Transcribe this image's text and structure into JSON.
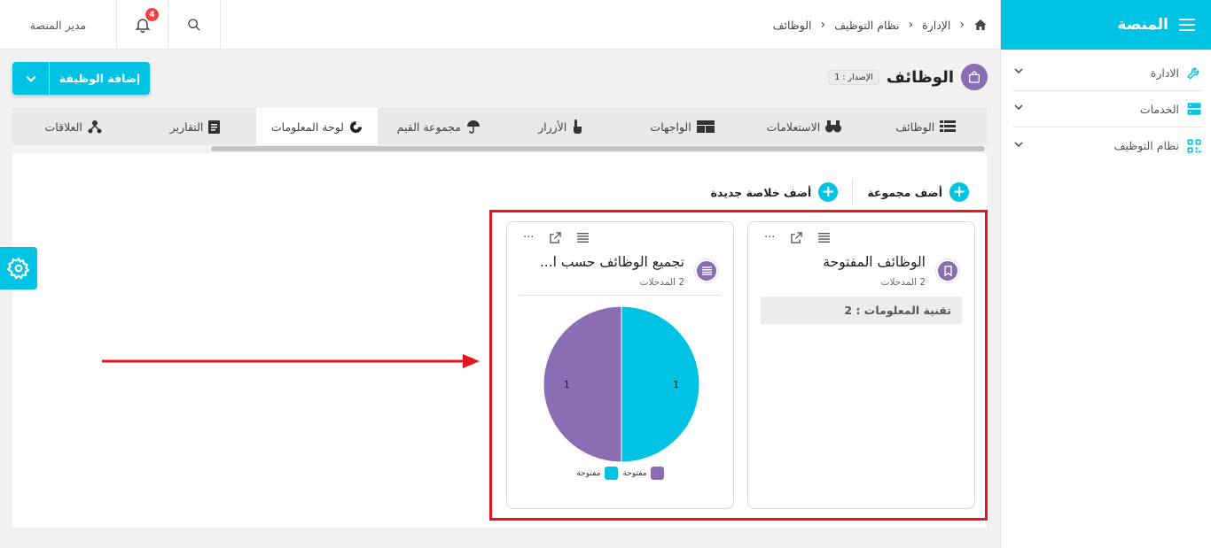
{
  "sidebar": {
    "title": "المنصة",
    "items": [
      {
        "label": "الادارة",
        "icon": "wrench-icon"
      },
      {
        "label": "الخدمات",
        "icon": "server-icon"
      },
      {
        "label": "نظام التوظيف",
        "icon": "qrcode-icon"
      }
    ]
  },
  "topbar": {
    "breadcrumbs": [
      "الإدارة",
      "نظام التوظيف",
      "الوظائف"
    ],
    "user_label": "مدير المنصة",
    "notification_count": "4"
  },
  "page": {
    "title": "الوظائف",
    "version_label": "الإصدار : 1",
    "add_button_label": "إضافة الوظيفة"
  },
  "tabs": [
    {
      "label": "الوظائف",
      "icon": "table-icon"
    },
    {
      "label": "الاستعلامات",
      "icon": "binoculars-icon"
    },
    {
      "label": "الواجهات",
      "icon": "layout-icon"
    },
    {
      "label": "الأزرار",
      "icon": "pointer-icon"
    },
    {
      "label": "مجموعة القيم",
      "icon": "umbrella-icon"
    },
    {
      "label": "لوحة المعلومات",
      "icon": "pie-icon",
      "active": true
    },
    {
      "label": "التقارير",
      "icon": "report-icon"
    },
    {
      "label": "العلاقات",
      "icon": "network-icon"
    }
  ],
  "actions": {
    "add_group": "أضف مجموعة",
    "add_summary": "أضف خلاصة جديدة"
  },
  "cards": [
    {
      "title": "الوظائف المفتوحة",
      "entries": "2 المدخلات",
      "row_label": "تقنية المعلومات : 2"
    },
    {
      "title": "تجميع الوظائف حسب ا...",
      "entries": "2 المدخلات"
    }
  ],
  "colors": {
    "accent": "#00c3e3",
    "purple": "#8b6db3",
    "highlight": "#e8161c"
  },
  "chart_data": {
    "type": "pie",
    "categories": [
      "مفتوحة",
      "مفتوحة"
    ],
    "values": [
      1,
      1
    ],
    "colors": [
      "#00c3e3",
      "#8b6db3"
    ],
    "title": "",
    "legend": "bottom"
  }
}
